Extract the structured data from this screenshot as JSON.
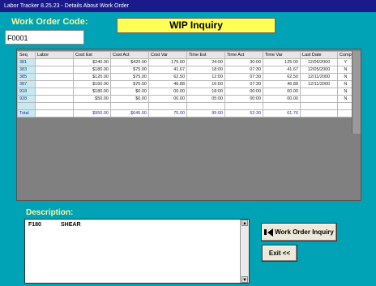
{
  "window": {
    "title": "Labor Tracker 8.25.23 - Details About Work Order"
  },
  "work_order": {
    "label": "Work Order Code:",
    "value": "F0001"
  },
  "header": {
    "title": "WIP Inquiry"
  },
  "grid": {
    "columns": [
      "Seq",
      "Labor",
      "Cost Est",
      "Cost Act",
      "Cost Var",
      "Time Est",
      "Time Act",
      "Time Var",
      "Last Date",
      "Comp"
    ],
    "rows": [
      [
        "381",
        "",
        "$240.00",
        "$420.00",
        "175.00",
        "24:00",
        "30:00",
        "125.00",
        "12/06/2000",
        "Y"
      ],
      [
        "383",
        "",
        "$180.00",
        "$75.00",
        "41.67",
        "18:00",
        "07:30",
        "41.67",
        "12/05/2000",
        "N"
      ],
      [
        "385",
        "",
        "$120.00",
        "$75.00",
        "62.50",
        "12:00",
        "07:30",
        "62.50",
        "12/11/2000",
        "N"
      ],
      [
        "387",
        "",
        "$160.00",
        "$75.00",
        "46.88",
        "16:00",
        "07:30",
        "46.88",
        "12/11/2000",
        "N"
      ],
      [
        "918",
        "",
        "$180.00",
        "$0.00",
        "00.00",
        "18:00",
        "00:00",
        "00.00",
        "",
        "N"
      ],
      [
        "928",
        "",
        "$50.00",
        "$0.00",
        "00.00",
        "05:00",
        "00:00",
        "00.00",
        "",
        "N"
      ],
      [
        "",
        "",
        "",
        "",
        "",
        "",
        "",
        "",
        "",
        ""
      ]
    ],
    "total": [
      "Total",
      "",
      "$950.00",
      "$645.00",
      "75.00",
      "95:00",
      "52:30",
      "61.76",
      "",
      ""
    ]
  },
  "description": {
    "label": "Description:",
    "code": "F180",
    "text": "SHEAR"
  },
  "buttons": {
    "work_order_inquiry": "Work Order Inquiry",
    "exit": "Exit <<"
  },
  "colors": {
    "titlebar": "#1a1a8a",
    "background": "#00a3b5",
    "title_box": "#ffff55",
    "label_text": "#fff5a0"
  }
}
